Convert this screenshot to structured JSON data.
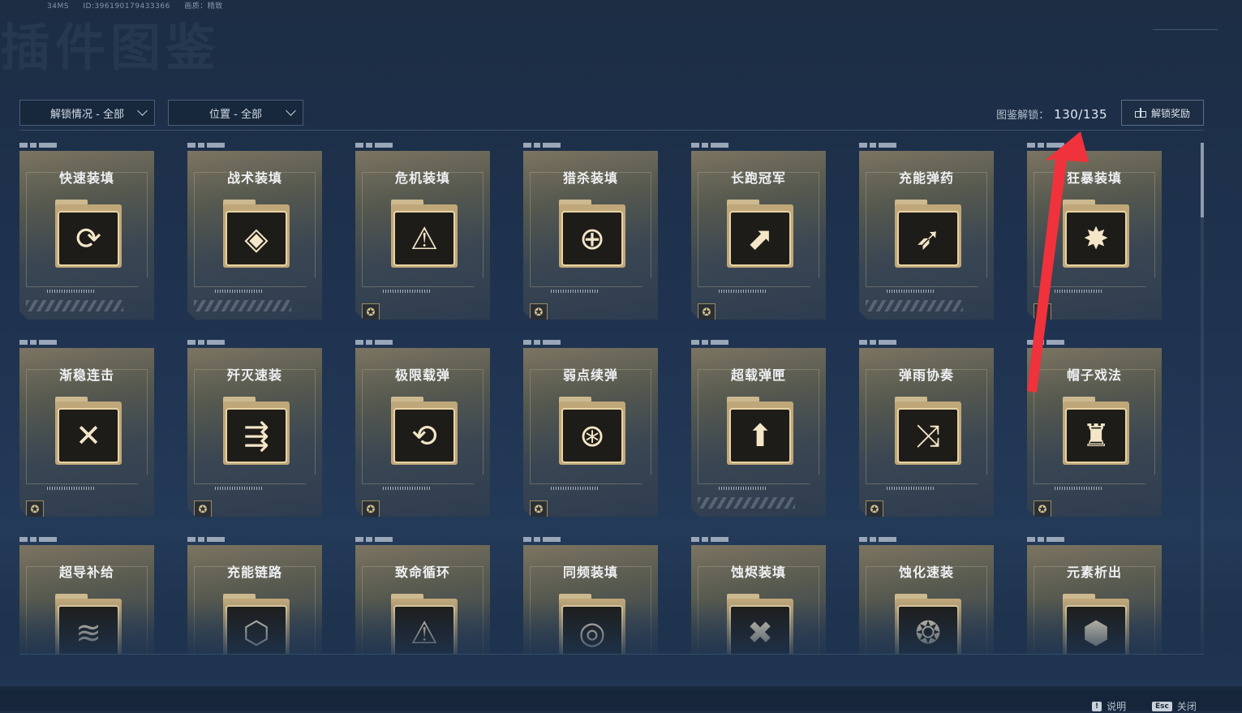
{
  "hud": {
    "fps": "34MS",
    "id": "ID:396190179433366",
    "quality": "画质：精致"
  },
  "page_title_watermark": "插件图鉴",
  "filters": [
    {
      "label": "解锁情况 - 全部"
    },
    {
      "label": "位置 - 全部"
    }
  ],
  "progress": {
    "label": "图鉴解锁：",
    "value": "130/135"
  },
  "reward_button": {
    "label": "解锁奖励",
    "icon": "gift-icon"
  },
  "cards": [
    {
      "name": "快速装填",
      "glyph": "⟳",
      "badge": false
    },
    {
      "name": "战术装填",
      "glyph": "◈",
      "badge": false
    },
    {
      "name": "危机装填",
      "glyph": "⚠",
      "badge": true
    },
    {
      "name": "猎杀装填",
      "glyph": "⊕",
      "badge": true
    },
    {
      "name": "长跑冠军",
      "glyph": "⬈",
      "badge": true
    },
    {
      "name": "充能弹药",
      "glyph": "➶",
      "badge": false
    },
    {
      "name": "狂暴装填",
      "glyph": "✸",
      "badge": true
    },
    {
      "name": "渐稳连击",
      "glyph": "✕",
      "badge": true
    },
    {
      "name": "歼灭速装",
      "glyph": "⇶",
      "badge": true
    },
    {
      "name": "极限载弹",
      "glyph": "⟲",
      "badge": true
    },
    {
      "name": "弱点续弹",
      "glyph": "⊛",
      "badge": true
    },
    {
      "name": "超载弹匣",
      "glyph": "⬆",
      "badge": false
    },
    {
      "name": "弹雨协奏",
      "glyph": "⤨",
      "badge": true
    },
    {
      "name": "帽子戏法",
      "glyph": "♜",
      "badge": true
    },
    {
      "name": "超导补给",
      "glyph": "≋",
      "badge": false
    },
    {
      "name": "充能链路",
      "glyph": "⬡",
      "badge": false
    },
    {
      "name": "致命循环",
      "glyph": "⚠",
      "badge": false
    },
    {
      "name": "同频装填",
      "glyph": "◎",
      "badge": false
    },
    {
      "name": "蚀烬装填",
      "glyph": "✖",
      "badge": false
    },
    {
      "name": "蚀化速装",
      "glyph": "❂",
      "badge": false
    },
    {
      "name": "元素析出",
      "glyph": "⬢",
      "badge": false
    }
  ],
  "footer": [
    {
      "key": "!",
      "label": "说明"
    },
    {
      "key": "Esc",
      "label": "关闭"
    }
  ],
  "colors": {
    "annotation_arrow": "#f0323c",
    "accent_gold": "#e7d3a4"
  }
}
